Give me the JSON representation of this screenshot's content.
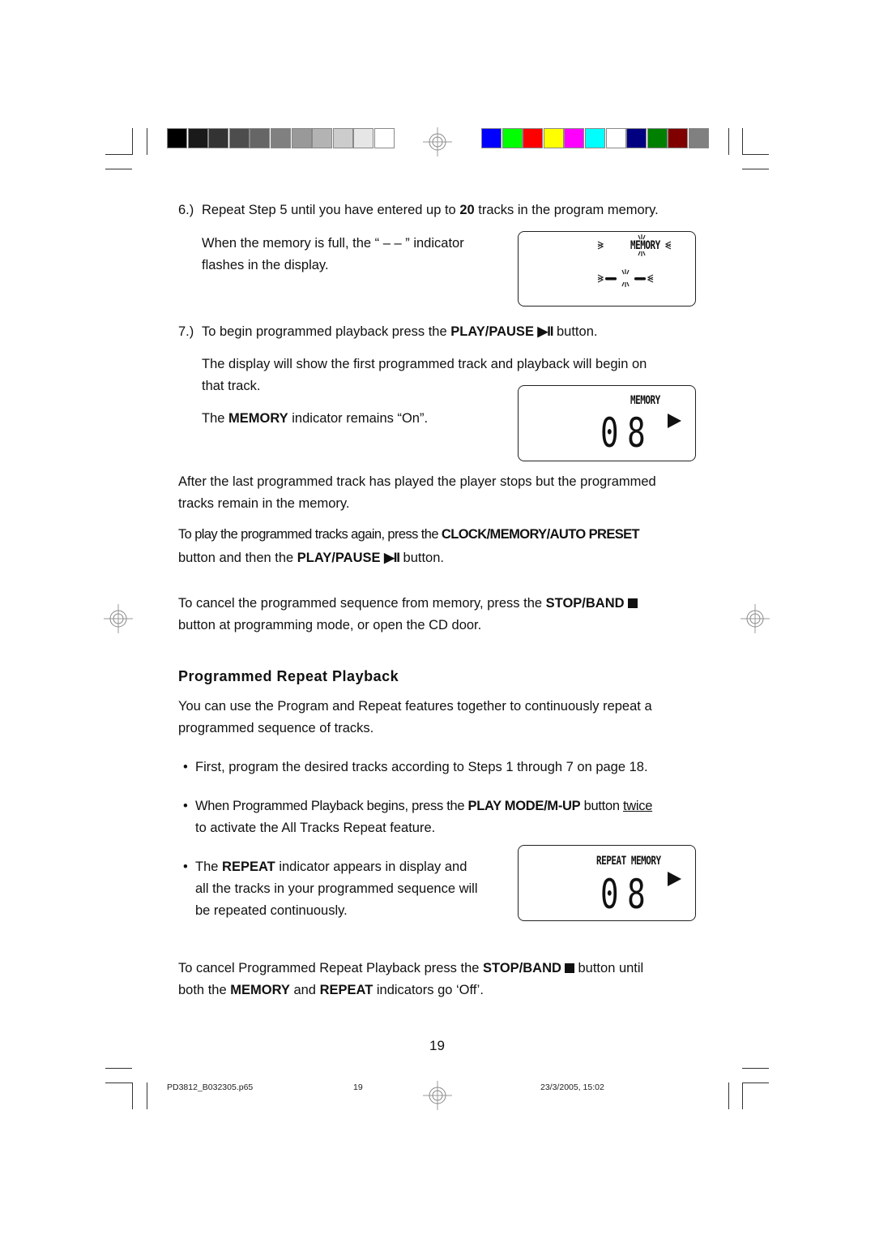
{
  "print_marks": {
    "grayscale_swatches": [
      "#000000",
      "#1a1a1a",
      "#333333",
      "#4d4d4d",
      "#666666",
      "#808080",
      "#999999",
      "#b3b3b3",
      "#cccccc",
      "#e6e6e6",
      "#ffffff"
    ],
    "color_swatches": [
      "#0000ff",
      "#00ff00",
      "#ff0000",
      "#ffff00",
      "#ff00ff",
      "#00ffff",
      "#ffffff",
      "#000080",
      "#008000",
      "#800000",
      "#808080"
    ]
  },
  "step6": {
    "number": "6.)",
    "text_before": "Repeat Step 5 until you have entered up to ",
    "bold": "20",
    "text_after": " tracks in the program memory.",
    "note_line1": "When the memory is full, the “ – – ” indicator",
    "note_line2": "flashes in the display."
  },
  "display1": {
    "label": "MEMORY",
    "value": "– –"
  },
  "step7": {
    "number": "7.)",
    "text_before": "To begin programmed playback press the ",
    "bold": "PLAY/PAUSE",
    "icon": "▶II",
    "text_after": " button.",
    "para1_line1": "The display will show the first programmed track and playback will begin on",
    "para1_line2": "that track.",
    "para2_before": "The ",
    "para2_bold": "MEMORY",
    "para2_after": " indicator remains “On”."
  },
  "display2": {
    "label": "MEMORY",
    "value": "08"
  },
  "after_para": {
    "line1": "After the last programmed track has played the player stops but the programmed",
    "line2": "tracks remain in the memory."
  },
  "replay_para": {
    "line1_before": "To play the programmed tracks again, press the ",
    "line1_bold": "CLOCK/MEMORY/AUTO PRESET",
    "line2_before": "button and then the ",
    "line2_bold": "PLAY/PAUSE",
    "line2_icon": "▶II",
    "line2_after": " button."
  },
  "cancel_para": {
    "line1_before": "To cancel the programmed sequence from memory, press the ",
    "line1_bold": "STOP/BAND",
    "line2": "button at programming mode, or open the CD door."
  },
  "section": {
    "title": "Programmed Repeat Playback",
    "intro_line1": "You can use the Program and Repeat features together to continuously repeat a",
    "intro_line2": "programmed sequence of tracks.",
    "bullet_char": "•",
    "bullet1": "First, program the desired tracks according to Steps 1 through 7 on page 18.",
    "bullet2_before": "When Programmed Playback begins, press the ",
    "bullet2_bold": "PLAY MODE/M-UP",
    "bullet2_mid": " button ",
    "bullet2_underline": "twice",
    "bullet2_line2": "to activate the All Tracks Repeat feature.",
    "bullet3_before": "The ",
    "bullet3_bold": "REPEAT",
    "bullet3_after": " indicator appears in display and",
    "bullet3_line2": "all the tracks in your programmed sequence will",
    "bullet3_line3": "be repeated continuously."
  },
  "display3": {
    "label": "REPEAT MEMORY",
    "value": "08"
  },
  "final_para": {
    "line1_before": "To cancel Programmed Repeat Playback press the ",
    "line1_bold": "STOP/BAND",
    "line1_after": " button until",
    "line2_before": "both the ",
    "line2_bold1": "MEMORY",
    "line2_mid": " and ",
    "line2_bold2": "REPEAT",
    "line2_after": " indicators go ‘Off’."
  },
  "page_number": "19",
  "footer": {
    "filename": "PD3812_B032305.p65",
    "page": "19",
    "timestamp": "23/3/2005, 15:02"
  }
}
